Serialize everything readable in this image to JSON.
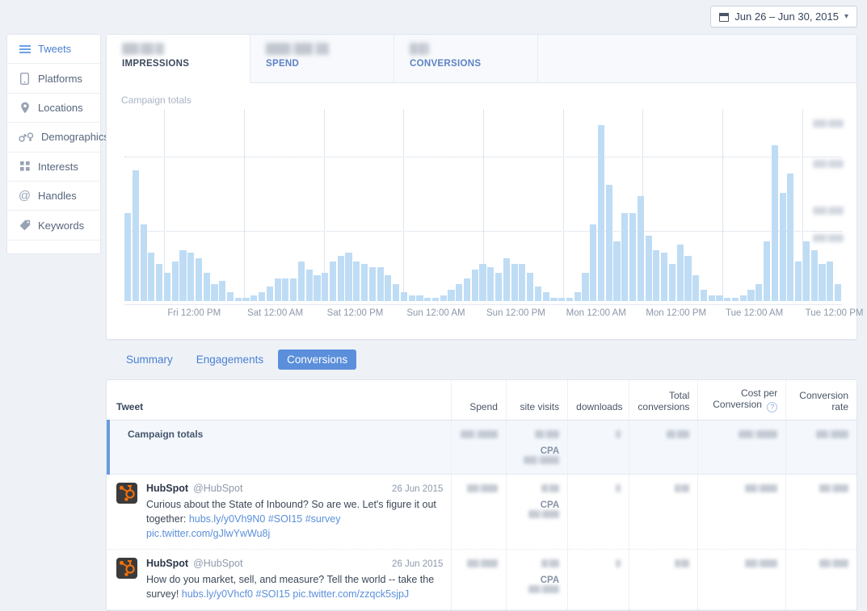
{
  "topbar": {
    "date_range": "Jun 26 – Jun 30, 2015",
    "calendar_icon": "calendar-icon",
    "chevron": "⌄"
  },
  "sidebar": {
    "items": [
      {
        "label": "Tweets",
        "icon": "list-icon",
        "active": true
      },
      {
        "label": "Platforms",
        "icon": "phone-icon",
        "active": false
      },
      {
        "label": "Locations",
        "icon": "pin-icon",
        "active": false
      },
      {
        "label": "Demographics",
        "icon": "gender-icon",
        "active": false
      },
      {
        "label": "Interests",
        "icon": "grid-icon",
        "active": false
      },
      {
        "label": "Handles",
        "icon": "at-icon",
        "active": false
      },
      {
        "label": "Keywords",
        "icon": "tag-icon",
        "active": false
      }
    ]
  },
  "metrics": [
    {
      "label": "IMPRESSIONS",
      "value": "",
      "redacted": true,
      "active": true
    },
    {
      "label": "SPEND",
      "value": "",
      "redacted": true,
      "active": false
    },
    {
      "label": "CONVERSIONS",
      "value": "",
      "redacted": true,
      "active": false
    }
  ],
  "chart_data": {
    "type": "bar",
    "title": "Campaign totals",
    "xlabel": "",
    "ylabel": "",
    "grid": true,
    "legend_position": "none",
    "ylim": [
      0,
      100
    ],
    "y_ticks_redacted": true,
    "y_tick_labels": [
      "",
      "",
      "",
      ""
    ],
    "x_tick_labels": [
      "Fri 12:00 PM",
      "Sat 12:00 AM",
      "Sat 12:00 PM",
      "Sun 12:00 AM",
      "Sun 12:00 PM",
      "Mon 12:00 AM",
      "Mon 12:00 PM",
      "Tue 12:00 AM",
      "Tue 12:00 PM"
    ],
    "bar_color": "#bfdcf5",
    "values": [
      31,
      46,
      27,
      17,
      13,
      10,
      14,
      18,
      17,
      15,
      10,
      6,
      7,
      3,
      1,
      1,
      2,
      3,
      5,
      8,
      8,
      8,
      14,
      11,
      9,
      10,
      14,
      16,
      17,
      14,
      13,
      12,
      12,
      9,
      6,
      3,
      2,
      2,
      1,
      1,
      2,
      4,
      6,
      8,
      11,
      13,
      12,
      10,
      15,
      13,
      13,
      10,
      5,
      3,
      1,
      1,
      1,
      3,
      10,
      27,
      62,
      41,
      21,
      31,
      31,
      37,
      23,
      18,
      17,
      13,
      20,
      16,
      9,
      4,
      2,
      2,
      1,
      1,
      2,
      4,
      6,
      21,
      55,
      38,
      45,
      14,
      21,
      18,
      13,
      14,
      6
    ]
  },
  "subtabs": [
    {
      "label": "Summary",
      "active": false
    },
    {
      "label": "Engagements",
      "active": false
    },
    {
      "label": "Conversions",
      "active": true
    }
  ],
  "table": {
    "columns": [
      {
        "label": "Tweet",
        "align": "left"
      },
      {
        "label": "Spend",
        "align": "right"
      },
      {
        "label": "site visits",
        "align": "right"
      },
      {
        "label": "downloads",
        "align": "right"
      },
      {
        "label": "Total conversions",
        "align": "right"
      },
      {
        "label": "Cost per Conversion",
        "align": "right",
        "help_icon": "question-mark-icon"
      },
      {
        "label": "Conversion rate",
        "align": "right"
      }
    ],
    "cpa_label": "CPA",
    "rows": [
      {
        "type": "totals",
        "label": "Campaign totals",
        "spend": "",
        "site_visits": "",
        "cpa": "",
        "downloads": "",
        "total_conversions": "",
        "cost_per_conversion": "",
        "conversion_rate": "",
        "redacted": true
      },
      {
        "type": "tweet",
        "name": "HubSpot",
        "handle": "@HubSpot",
        "date": "26 Jun 2015",
        "text_before": "Curious about the State of Inbound? So are we. Let's figure it out together: ",
        "links": [
          "hubs.ly/y0Vh9N0",
          "#SOI15",
          "#survey",
          "pic.twitter.com/gJlwYwWu8j"
        ],
        "spend": "",
        "site_visits": "",
        "cpa": "",
        "downloads": "",
        "total_conversions": "",
        "cost_per_conversion": "",
        "conversion_rate": "",
        "redacted": true
      },
      {
        "type": "tweet",
        "name": "HubSpot",
        "handle": "@HubSpot",
        "date": "26 Jun 2015",
        "text_before": "How do you market, sell, and measure? Tell the world -- take the survey! ",
        "links": [
          "hubs.ly/y0Vhcf0",
          "#SOI15",
          "pic.twitter.com/zzqck5sjpJ"
        ],
        "spend": "",
        "site_visits": "",
        "cpa": "",
        "downloads": "",
        "total_conversions": "",
        "cost_per_conversion": "",
        "conversion_rate": "",
        "redacted": true
      }
    ]
  },
  "colors": {
    "accent": "#5b8fdb",
    "bar": "#bfdcf5",
    "link": "#5b8fdb",
    "page_bg": "#eef2f7"
  }
}
